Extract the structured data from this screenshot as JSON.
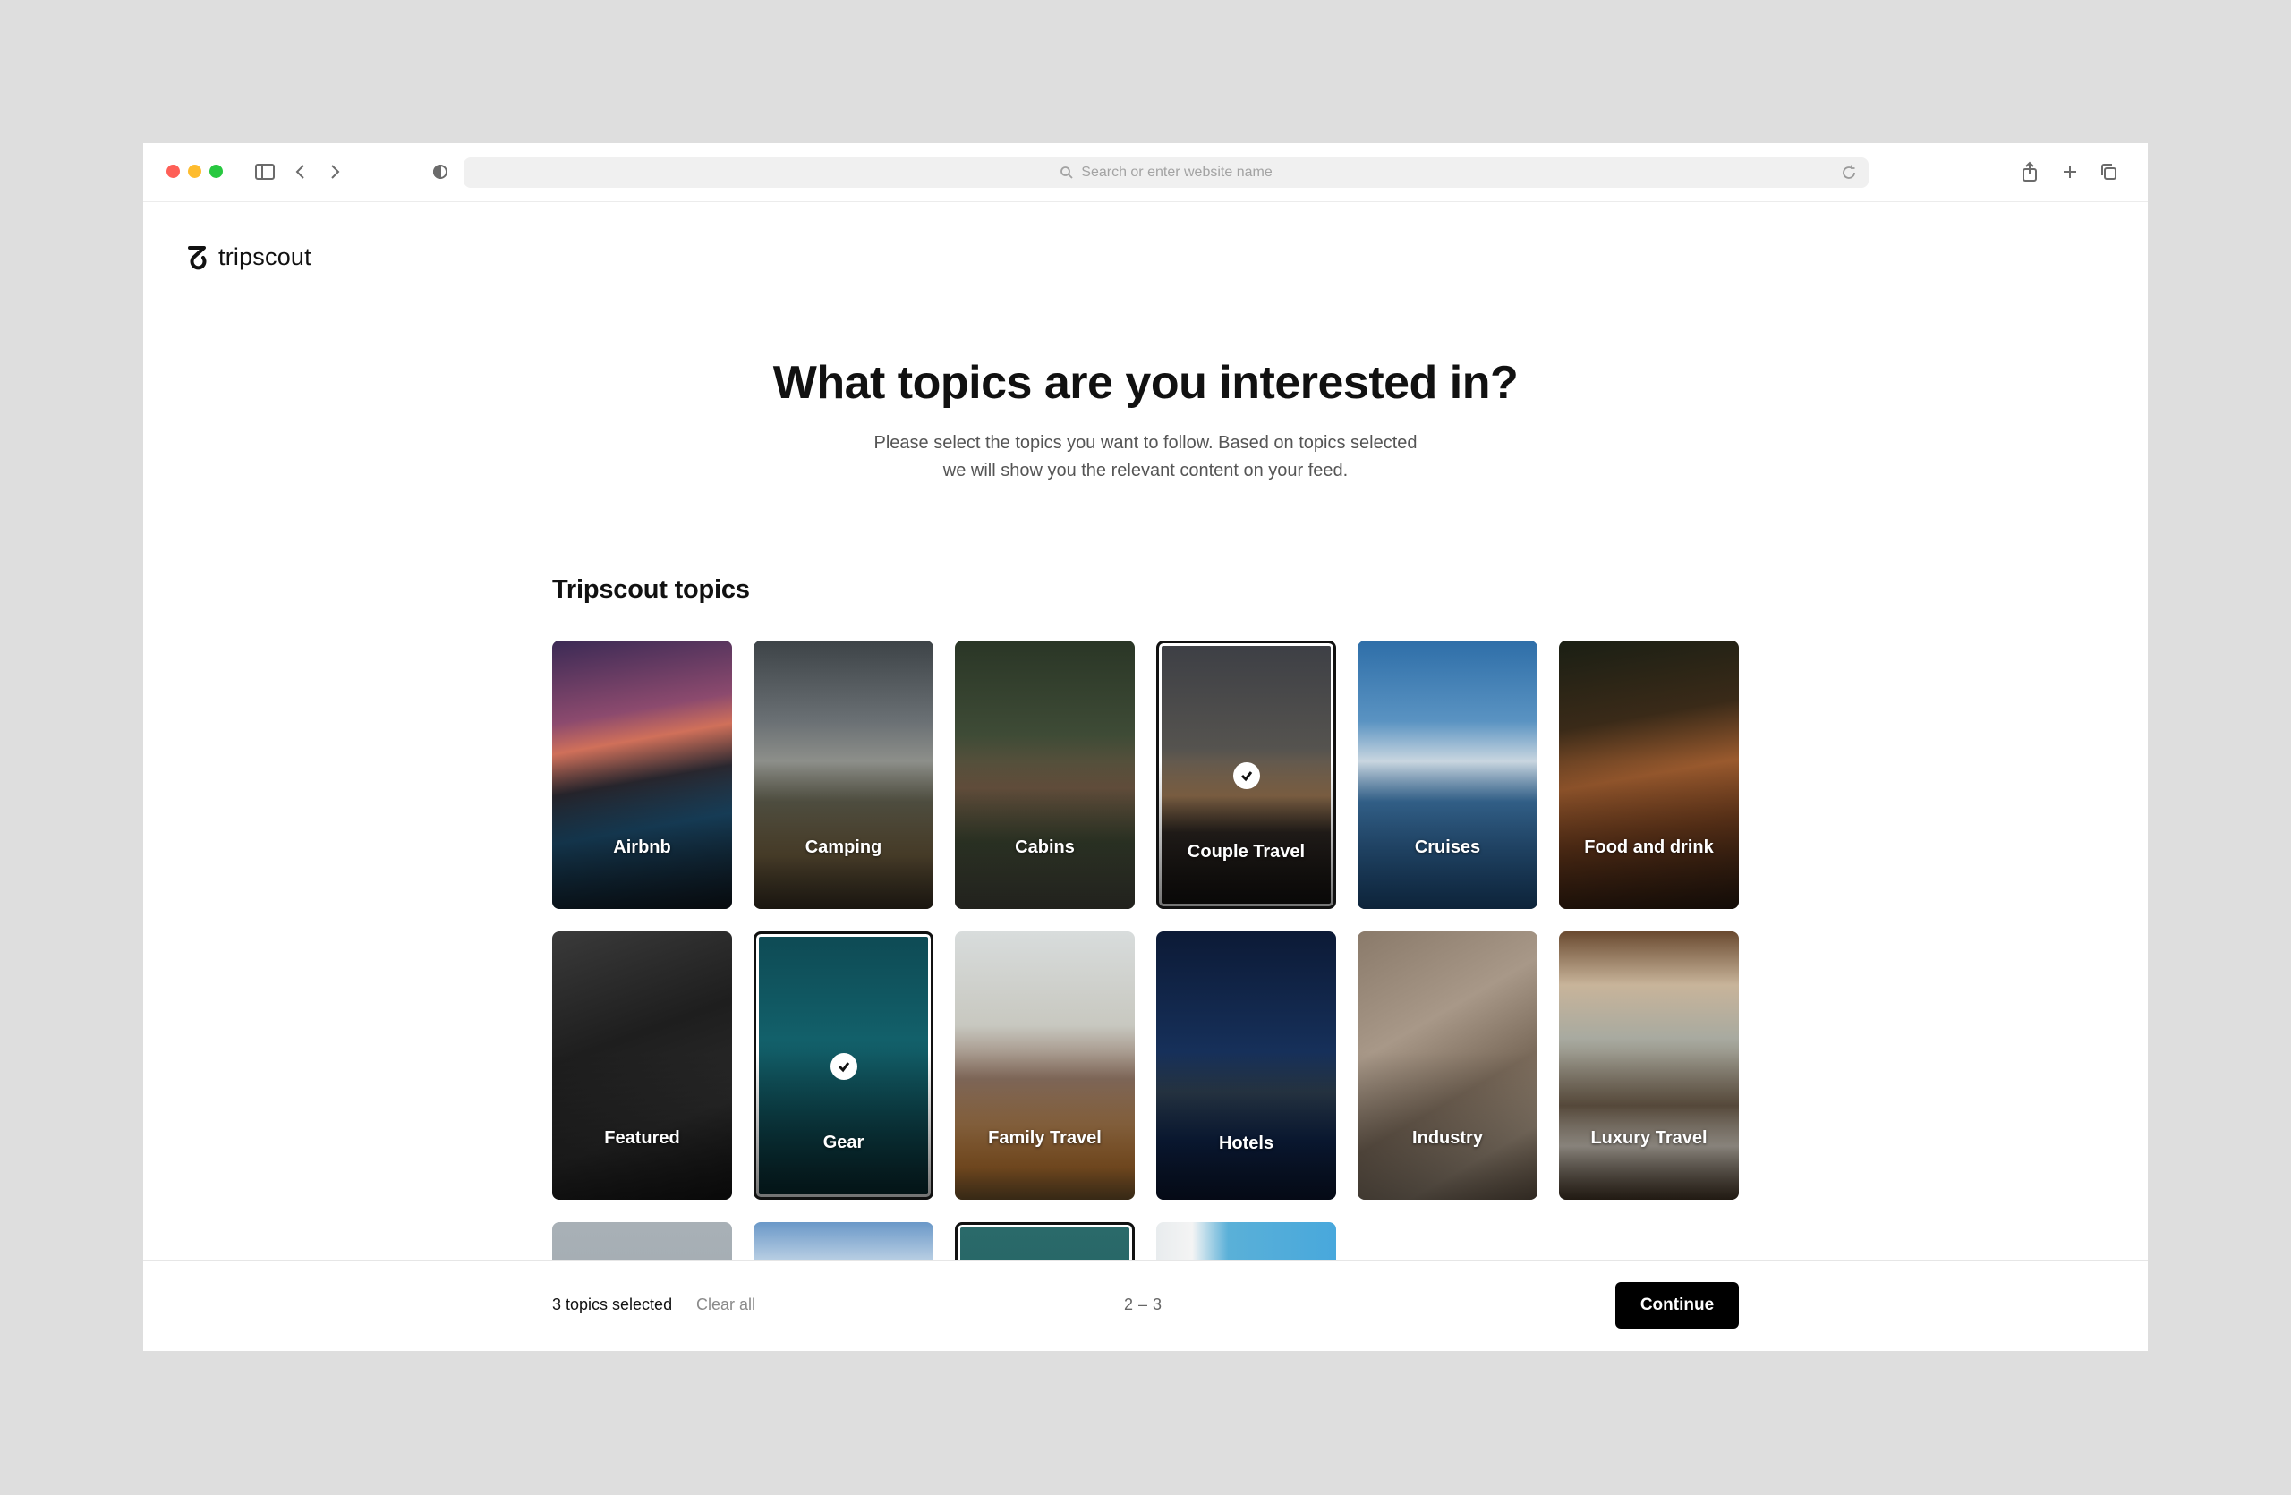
{
  "browser": {
    "address_placeholder": "Search or enter website name"
  },
  "brand": {
    "name": "tripscout"
  },
  "page": {
    "headline": "What topics are you interested in?",
    "subtext_line1": "Please select the topics you want to follow. Based on topics selected",
    "subtext_line2": "we will show you the relevant content on your feed.",
    "section_title": "Tripscout topics"
  },
  "topics": [
    {
      "label": "Airbnb",
      "selected": false
    },
    {
      "label": "Camping",
      "selected": false
    },
    {
      "label": "Cabins",
      "selected": false
    },
    {
      "label": "Couple Travel",
      "selected": true
    },
    {
      "label": "Cruises",
      "selected": false
    },
    {
      "label": "Food and drink",
      "selected": false
    },
    {
      "label": "Featured",
      "selected": false
    },
    {
      "label": "Gear",
      "selected": true
    },
    {
      "label": "Family Travel",
      "selected": false
    },
    {
      "label": "Hotels",
      "selected": false
    },
    {
      "label": "Industry",
      "selected": false
    },
    {
      "label": "Luxury Travel",
      "selected": false
    }
  ],
  "footer": {
    "selected_count": "3 topics selected",
    "clear_all": "Clear all",
    "page_from": "2",
    "page_sep": "–",
    "page_to": "3",
    "continue_label": "Continue"
  },
  "colors": {
    "accent": "#000000",
    "page_bg": "#dedede"
  }
}
